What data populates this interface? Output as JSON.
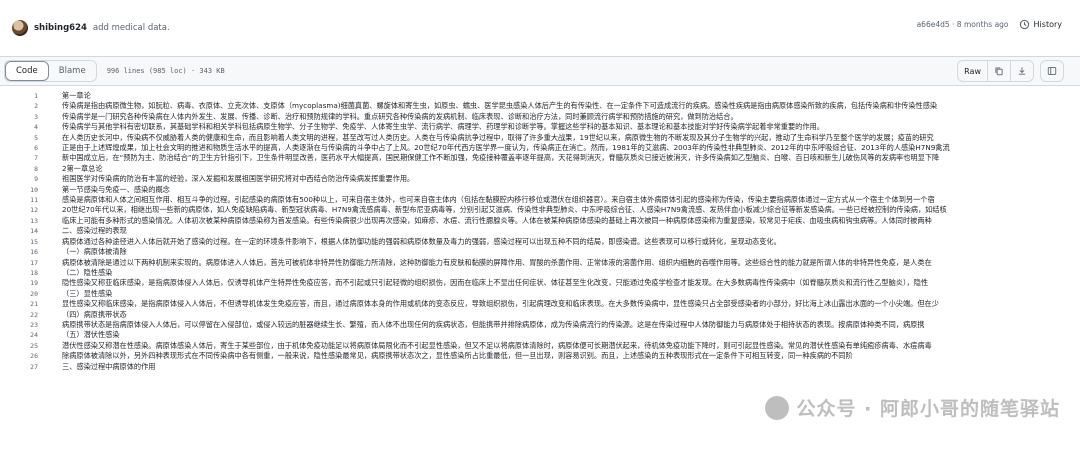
{
  "commit": {
    "author": "shibing624",
    "message": "add medical data.",
    "meta": "a66e4d5 · 8 months ago",
    "history_label": "History"
  },
  "toolbar": {
    "code_tab": "Code",
    "blame_tab": "Blame",
    "file_info": "996 lines (985 loc) · 343 KB",
    "raw_label": "Raw"
  },
  "lines": [
    {
      "n": "1",
      "t": "第一章论"
    },
    {
      "n": "2",
      "t": "传染病是指由病原微生物，如朊粒、病毒、衣原体、立克次体、支原体（mycoplasma)细菌真菌、螺旋体和寄生虫，如原虫、蠕虫、医学昆虫感染人体后产生的有传染性、在一定条件下可造成流行的疾病。感染性疾病是指由病原体感染所致的疾病，包括传染病和非传染性感染"
    },
    {
      "n": "3",
      "t": "传染病学是一门研究各种传染病在人体内外发生、发展、传播、诊断、治疗和预防规律的学科。重点研究各种传染病的发病机制、临床表现、诊断和治疗方法，同时兼顾流行病学和预防措施的研究，做到防治结合。"
    },
    {
      "n": "4",
      "t": "传染病学与其他学科有密切联系，其基础学科和相关学科包括病原生物学、分子生物学、免疫学、人体寄生虫学、流行病学、病理学、药理学和诊断学等。掌握这些学科的基本知识、基本理论和基本技能对学好传染病学起着非常重要的作用。"
    },
    {
      "n": "5",
      "t": "在人类历史长河中，传染病不仅威胁着人类的健康和生命，而且影响着人类文明的进程，甚至改写过人类历史。人类在与传染病抗争过程中，取得了许多重大战果，19世纪以来，病原微生物的不断发现及其分子生物学的兴起，推动了生命科学乃至整个医学的发展；疫苗的研究"
    },
    {
      "n": "6",
      "t": "正是由于上述辉煌成果，加上社会文明的推进和物质生活水平的提高，人类逐渐在与传染病的斗争中占了上风。20世纪70年代西方医学界一度认为，传染病正在消亡。然而，1981年的艾滋病、2003年的传染性非典型肺炎、2012年的中东呼吸综合征、2013年的人感染H7N9禽流"
    },
    {
      "n": "7",
      "t": "新中国成立后，在“预防为主、防治结合”的卫生方针指引下，卫生条件明显改善，医药水平大幅提高，国民期保健工作不断加强，免疫接种覆盖率逐年提高，天花得到消灭，脊髓灰质炎已接近被消灭，许多传染病如乙型脑炎、白喉、百日咳和新生儿破伤风等的发病率也明显下降"
    },
    {
      "n": "8",
      "t": "2第一章总论"
    },
    {
      "n": "9",
      "t": "祖国医学对传染病的防治有丰富的经验，深入发掘和发展祖国医学研究将对中西结合防治传染病发挥重要作用。"
    },
    {
      "n": "10",
      "t": "第一节感染与免疫一、感染的概念"
    },
    {
      "n": "11",
      "t": "感染是病原体和人体之间相互作用、相互斗争的过程。引起感染的病原体有500种以上，可来自宿主体外，也可来自宿主体内（包括在黏膜腔内移行移位或潜伏在组织器官）。来自宿主体外病原体引起的感染称为传染，传染主要指病原体通过一定方式从一个宿主个体到另一个宿"
    },
    {
      "n": "12",
      "t": "20世纪70年代以来，相继出现一些新的病原体，如人免疫缺陷病毒、新型冠状病毒、H7N9禽流感病毒、新型布尼亚病毒等，分别引起艾滋病、传染性非典型肺炎、中东呼吸综合征、人感染H7N9禽流感、发热伴血小板减少综合征等新发感染病。一些已经被控制的传染病，如结核"
    },
    {
      "n": "13",
      "t": "临床上可能有多种形式的感染情况。人体初次被某种病原体感染称为首发感染。有些传染病很少出现再次感染，如麻疹、水痘、流行性腮腺炎等。人体在被某种病原体感染的基础上再次被同一种病原体感染称为重复感染，较常见于疟疾、血吸虫病和钩虫病等。人体同时被两种"
    },
    {
      "n": "14",
      "t": "二、感染过程的表现"
    },
    {
      "n": "15",
      "t": "病原体通过各种途径进入人体后就开始了感染的过程。在一定的环境条件影响下，根据人体防御功能的强弱和病原体数量及毒力的强弱，感染过程可以出现五种不同的结局，即感染谱。这些表现可以移行或转化，呈现动态变化。"
    },
    {
      "n": "16",
      "t": "（一）病原体被清除"
    },
    {
      "n": "17",
      "t": "病原体被清除是通过以下两种机制来实现的。病原体进入人体后，首先可被机体非特异性防御能力所清除，这种防御能力有皮肤和黏膜的屏障作用、胃酸的杀菌作用、正常体液的溶菌作用、组织内细胞的吞噬作用等。这些综合性的能力就是所谓人体的非特异性免疫，是人类在"
    },
    {
      "n": "18",
      "t": "（二）隐性感染"
    },
    {
      "n": "19",
      "t": "隐性感染又称亚临床感染，是指病原体侵入人体后，仅诱导机体产生特异性免疫应答，而不引起或只引起轻微的组织损伤，因而在临床上不显出任何症状、体征甚至生化改变，只能通过免疫学检查才能发现。在大多数病毒性传染病中（如脊髓灰质炎和流行性乙型脑炎），隐性"
    },
    {
      "n": "20",
      "t": "（三）显性感染"
    },
    {
      "n": "21",
      "t": "显性感染又称临床感染，是指病原体侵入人体后，不但诱导机体发生免疫应答，而且，通过病原体本身的作用或机体的变态反应，导致组织损伤，引起病理改变和临床表现。在大多数传染病中，显性感染只占全部受感染者的小部分，好比海上冰山露出水面的一个小尖端。但在少"
    },
    {
      "n": "22",
      "t": "（四）病原携带状态"
    },
    {
      "n": "23",
      "t": "病原携带状态是指病原体侵入人体后，可以停留在入侵部位，或侵入较远的脏器继续生长、繁殖，而人体不出现任何的疾病状态，但能携带并排除病原体，成为传染病流行的传染源。这是在传染过程中人体防御能力与病原体处于相持状态的表现。按病原体种类不同，病原携"
    },
    {
      "n": "24",
      "t": "（五）潜伏性感染"
    },
    {
      "n": "25",
      "t": "潜伏性感染又称潜在性感染。病原体感染人体后，寄生于某些部位，由于机体免疫功能足以将病原体局限化而不引起显性感染，但又不足以将病原体清除时，病原体便可长期潜伏起来，待机体免疫功能下降时，则可引起显性感染。常见的潜伏性感染有单纯疱疹病毒、水痘病毒"
    },
    {
      "n": "26",
      "t": "除病原体被清除以外，另外四种表现形式在不同传染病中各有侧重，一般来说，隐性感染最常见，病原携带状态次之，显性感染所占比重最低，但一旦出现，则容易识别。而且，上述感染的五种表现形式在一定条件下可相互转变，同一种疾病的不同阶"
    },
    {
      "n": "27",
      "t": "三、感染过程中病原体的作用"
    }
  ],
  "watermark": {
    "text": "公众号 · 阿郎小哥的随笔驿站"
  }
}
